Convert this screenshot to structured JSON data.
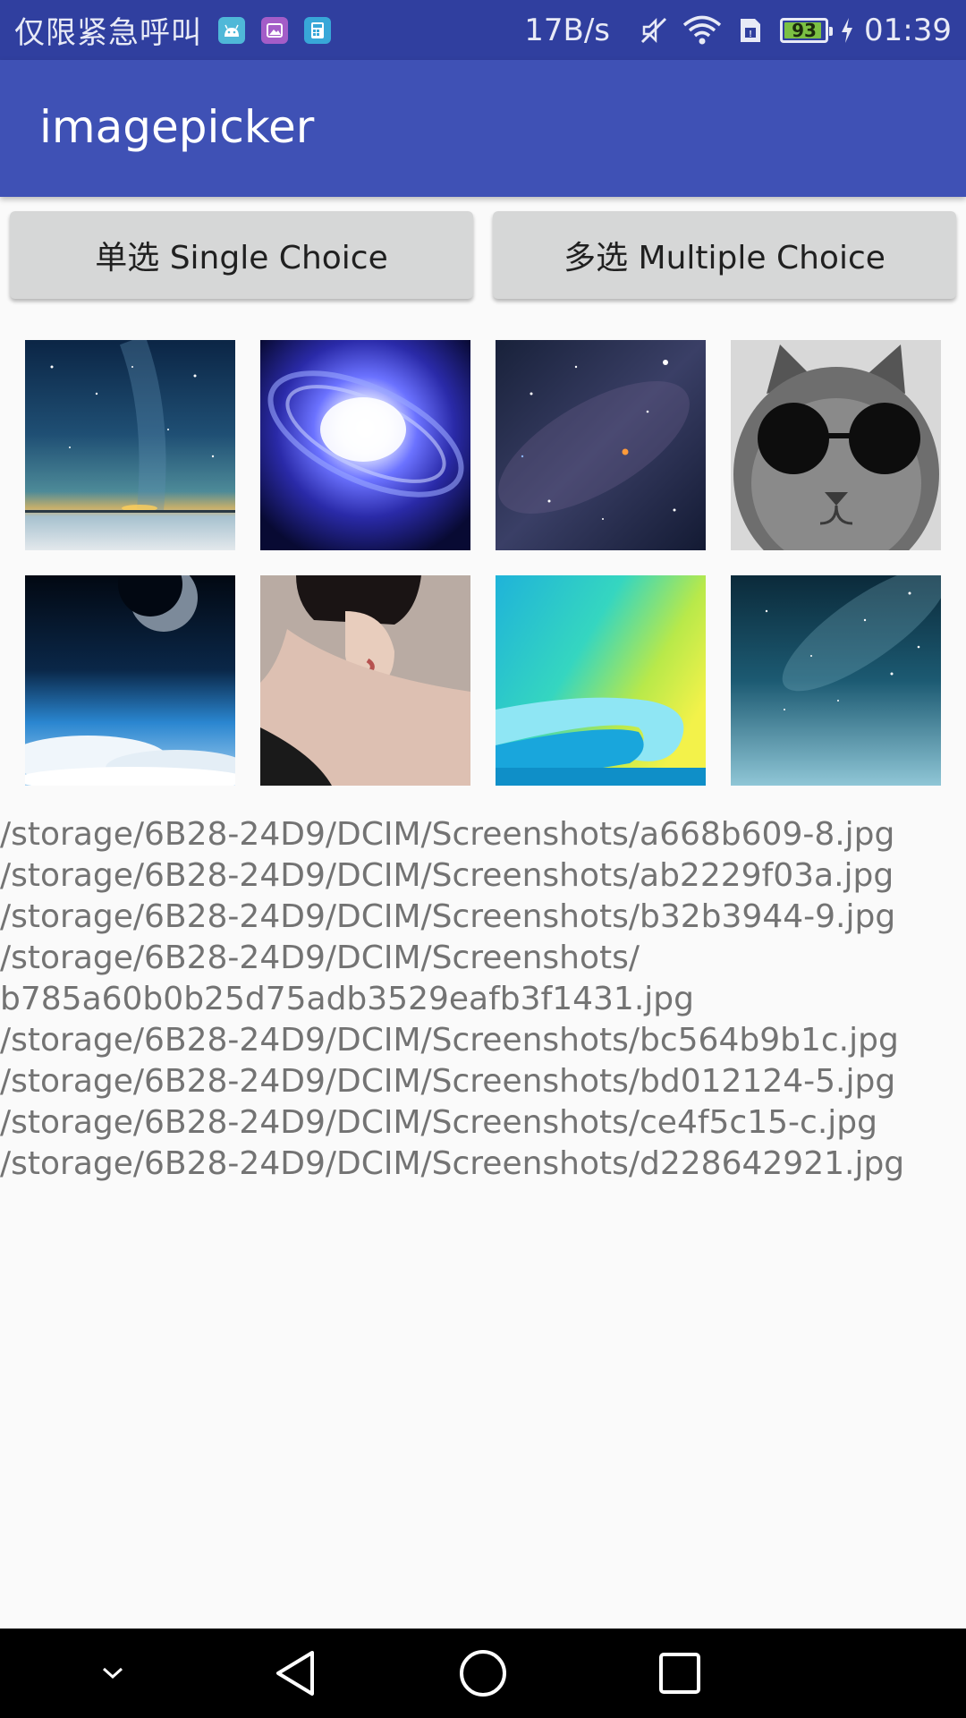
{
  "status_bar": {
    "carrier": "仅限紧急呼叫",
    "speed": "17B/s",
    "battery": "93",
    "battery_level": 0.93,
    "time": "01:39",
    "icons": [
      "android-icon",
      "gallery-icon",
      "calculator-icon",
      "mute-icon",
      "wifi-icon",
      "sim-icon",
      "battery-icon",
      "charging-icon"
    ]
  },
  "app_bar": {
    "title": "imagepicker"
  },
  "buttons": {
    "single": "单选 Single Choice",
    "multiple": "多选 Multiple Choice"
  },
  "images": [
    {
      "name": "thumb-starry-horizon"
    },
    {
      "name": "thumb-galaxy"
    },
    {
      "name": "thumb-star-field"
    },
    {
      "name": "thumb-cat-sunglasses"
    },
    {
      "name": "thumb-earth-moon"
    },
    {
      "name": "thumb-woman-portrait"
    },
    {
      "name": "thumb-wave"
    },
    {
      "name": "thumb-night-sky"
    }
  ],
  "paths": [
    "/storage/6B28-24D9/DCIM/Screenshots/a668b609-8.jpg",
    "/storage/6B28-24D9/DCIM/Screenshots/ab2229f03a.jpg",
    "/storage/6B28-24D9/DCIM/Screenshots/b32b3944-9.jpg",
    "/storage/6B28-24D9/DCIM/Screenshots/",
    "b785a60b0b25d75adb3529eafb3f1431.jpg",
    "/storage/6B28-24D9/DCIM/Screenshots/bc564b9b1c.jpg",
    "/storage/6B28-24D9/DCIM/Screenshots/bd012124-5.jpg",
    "/storage/6B28-24D9/DCIM/Screenshots/ce4f5c15-c.jpg",
    "/storage/6B28-24D9/DCIM/Screenshots/d228642921.jpg"
  ],
  "colors": {
    "status_bar": "#303f9f",
    "app_bar": "#3f51b5",
    "button": "#d6d7d7",
    "background": "#fafafa",
    "path_text": "#737373"
  }
}
